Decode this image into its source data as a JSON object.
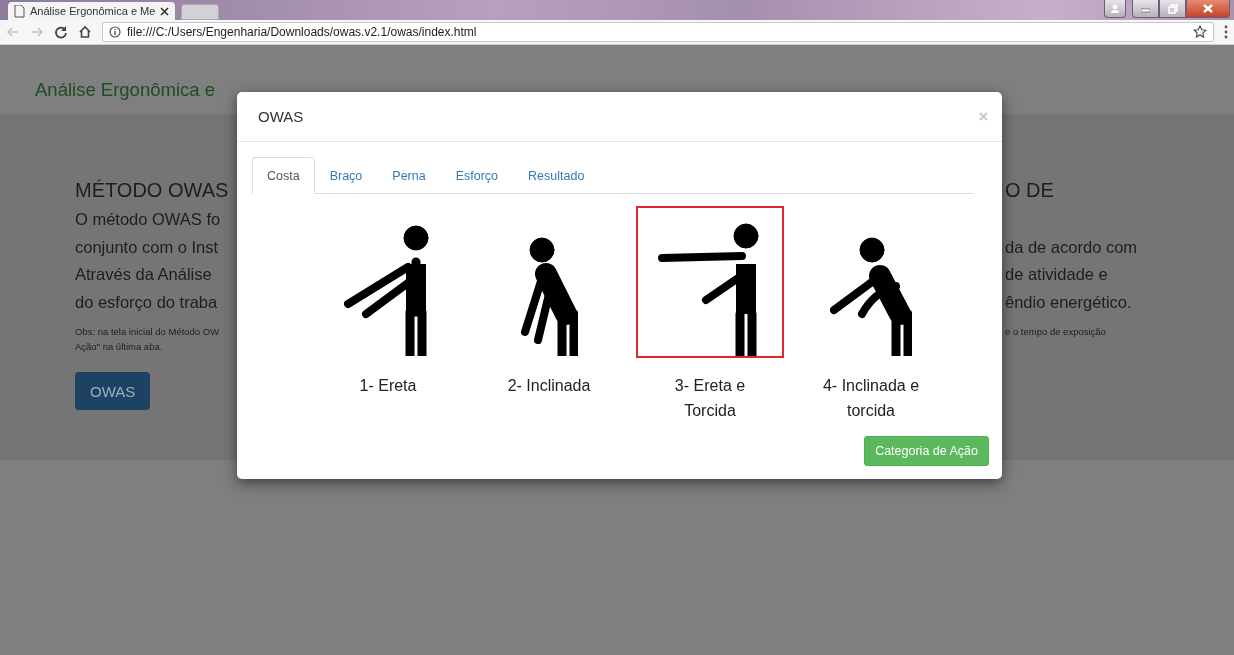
{
  "browser": {
    "tab_title": "Análise Ergonômica e Me",
    "url": "file:///C:/Users/Engenharia/Downloads/owas.v2.1/owas/index.html"
  },
  "page": {
    "brand": "Análise Ergonômica e",
    "left": {
      "heading": "MÉTODO OWAS",
      "lines": [
        "O método OWAS fo",
        "conjunto com o Inst",
        "Através da Análise",
        "do esforço do traba"
      ],
      "note_lines": [
        "Obs: na tela inicial do Método OW",
        "Ação\" na última aba."
      ],
      "button": "OWAS"
    },
    "right": {
      "heading": "O DE",
      "lines": [
        "da de acordo com",
        "de atividade e",
        "êndio energético."
      ],
      "note_lines": [
        "e o tempo de exposição"
      ]
    }
  },
  "modal": {
    "title": "OWAS",
    "tabs": [
      {
        "label": "Costa",
        "selected": true
      },
      {
        "label": "Braço",
        "selected": false
      },
      {
        "label": "Perna",
        "selected": false
      },
      {
        "label": "Esforço",
        "selected": false
      },
      {
        "label": "Resultado",
        "selected": false
      }
    ],
    "postures": [
      {
        "kind": "upright",
        "label": "1- Ereta",
        "selected": false
      },
      {
        "kind": "bent",
        "label": "2- Inclinada",
        "selected": false
      },
      {
        "kind": "twisted",
        "label": "3- Ereta e Torcida",
        "selected": true
      },
      {
        "kind": "bent-twisted",
        "label": "4- Inclinada e torcida",
        "selected": false
      }
    ],
    "button": "Categoria de Ação"
  }
}
